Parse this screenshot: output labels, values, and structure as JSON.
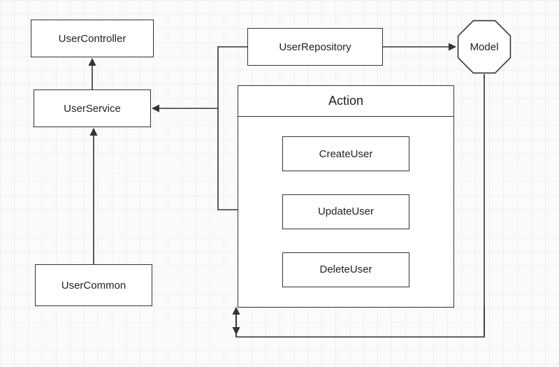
{
  "nodes": {
    "userController": "UserController",
    "userService": "UserService",
    "userCommon": "UserCommon",
    "userRepository": "UserRepository",
    "model": "Model",
    "action": {
      "title": "Action",
      "items": [
        "CreateUser",
        "UpdateUser",
        "DeleteUser"
      ]
    }
  },
  "edges": [
    {
      "from": "userService",
      "to": "userController",
      "style": "arrow"
    },
    {
      "from": "userCommon",
      "to": "userService",
      "style": "arrow"
    },
    {
      "from": "action",
      "to": "userService",
      "via": "userRepository-left",
      "style": "arrow"
    },
    {
      "from": "userRepository",
      "to": "model",
      "style": "arrow"
    },
    {
      "from": "action",
      "to": "bottom-bus",
      "style": "line"
    },
    {
      "from": "model",
      "to": "bottom-bus",
      "style": "line"
    }
  ]
}
